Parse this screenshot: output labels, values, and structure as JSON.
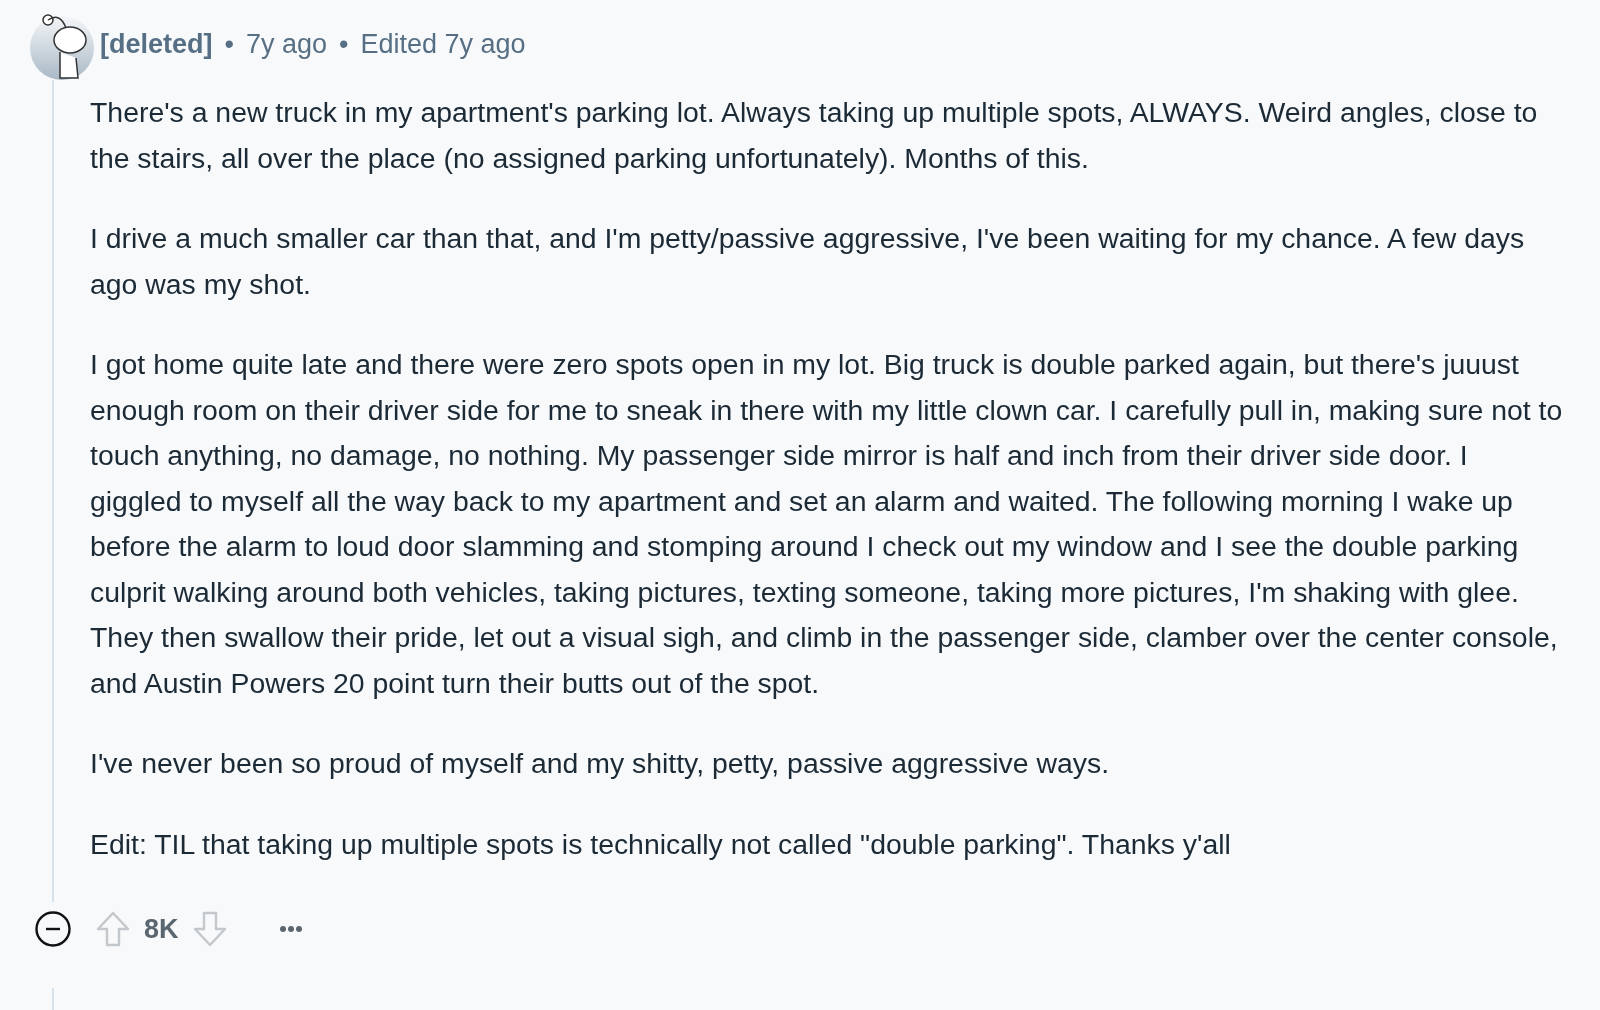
{
  "comment": {
    "author": "[deleted]",
    "separator_1": "•",
    "age": "7y ago",
    "separator_2": "•",
    "edited": "Edited 7y ago",
    "paragraphs": [
      "There's a new truck in my apartment's parking lot. Always taking up multiple spots, ALWAYS. Weird angles, close to the stairs, all over the place (no assigned parking unfortunately). Months of this.",
      "I drive a much smaller car than that, and I'm petty/passive aggressive, I've been waiting for my chance. A few days ago was my shot.",
      "I got home quite late and there were zero spots open in my lot. Big truck is double parked again, but there's juuust enough room on their driver side for me to sneak in there with my little clown car. I carefully pull in, making sure not to touch anything, no damage, no nothing. My passenger side mirror is half and inch from their driver side door. I giggled to myself all the way back to my apartment and set an alarm and waited. The following morning I wake up before the alarm to loud door slamming and stomping around I check out my window and I see the double parking culprit walking around both vehicles, taking pictures, texting someone, taking more pictures, I'm shaking with glee. They then swallow their pride, let out a visual sigh, and climb in the passenger side, clamber over the center console, and Austin Powers 20 point turn their butts out of the spot.",
      "I've never been so proud of myself and my shitty, petty, passive aggressive ways.",
      "Edit: TIL that taking up multiple spots is technically not called \"double parking\". Thanks y'all"
    ],
    "score": "8K"
  }
}
